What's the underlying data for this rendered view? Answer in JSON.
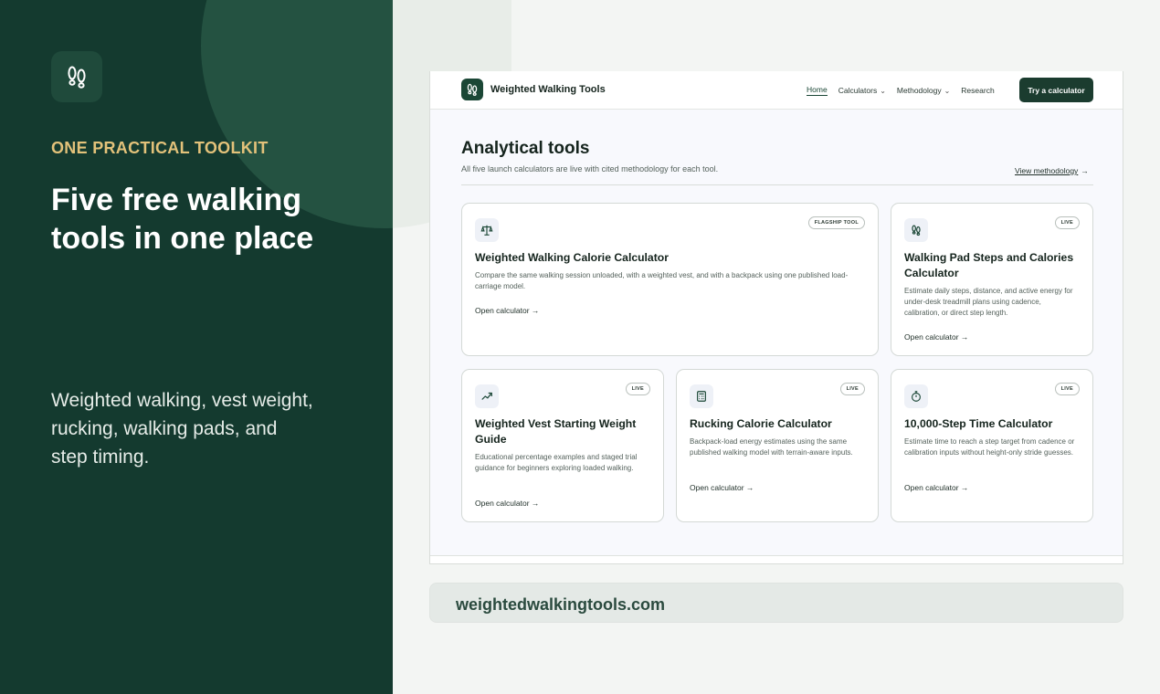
{
  "promo": {
    "kicker": "ONE PRACTICAL TOOLKIT",
    "headline": "Five free walking tools in one place",
    "subtext": "Weighted walking, vest weight, rucking, walking pads, and step timing."
  },
  "site": {
    "brand": "Weighted Walking Tools",
    "nav": {
      "home": "Home",
      "calculators": "Calculators",
      "methodology": "Methodology",
      "research": "Research",
      "cta": "Try a calculator"
    },
    "section": {
      "title": "Analytical tools",
      "subtitle": "All five launch calculators are live with cited methodology for each tool.",
      "link": "View methodology"
    },
    "cards": [
      {
        "badge": "FLAGSHIP TOOL",
        "icon": "scale-icon",
        "title": "Weighted Walking Calorie Calculator",
        "desc": "Compare the same walking session unloaded, with a weighted vest, and with a backpack using one published load-carriage model.",
        "link": "Open calculator"
      },
      {
        "badge": "LIVE",
        "icon": "footprints-icon",
        "title": "Walking Pad Steps and Calories Calculator",
        "desc": "Estimate daily steps, distance, and active energy for under-desk treadmill plans using cadence, calibration, or direct step length.",
        "link": "Open calculator"
      },
      {
        "badge": "LIVE",
        "icon": "trending-up-icon",
        "title": "Weighted Vest Starting Weight Guide",
        "desc": "Educational percentage examples and staged trial guidance for beginners exploring loaded walking.",
        "link": "Open calculator"
      },
      {
        "badge": "LIVE",
        "icon": "calculator-icon",
        "title": "Rucking Calorie Calculator",
        "desc": "Backpack-load energy estimates using the same published walking model with terrain-aware inputs.",
        "link": "Open calculator"
      },
      {
        "badge": "LIVE",
        "icon": "stopwatch-icon",
        "title": "10,000-Step Time Calculator",
        "desc": "Estimate time to reach a step target from cadence or calibration inputs without height-only stride guesses.",
        "link": "Open calculator"
      }
    ]
  },
  "url": "weightedwalkingtools.com",
  "colors": {
    "panel": "#143a2f",
    "accent_gold": "#e3c27a",
    "brand_green": "#1b4736"
  }
}
